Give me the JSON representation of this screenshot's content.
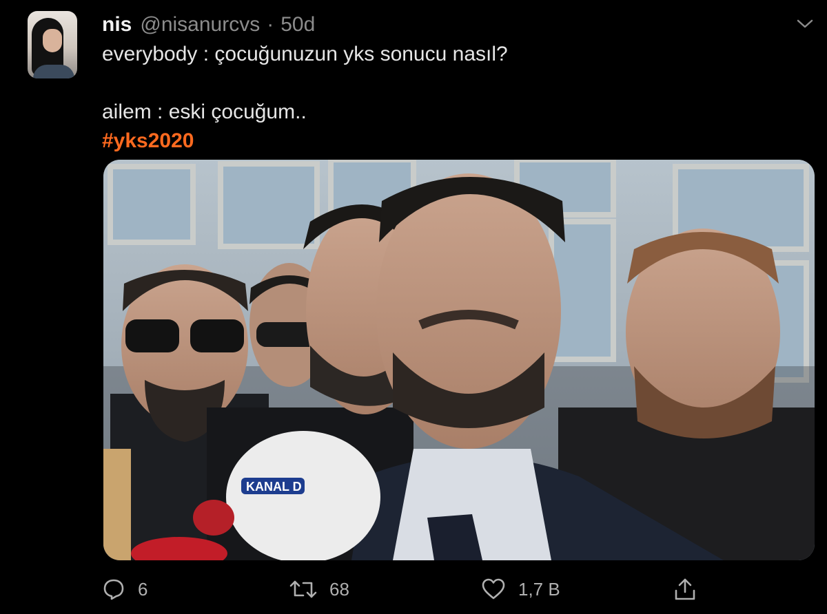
{
  "tweet": {
    "author_name": "nis",
    "author_handle": "@nisanurcvs",
    "separator": "·",
    "timestamp": "50d",
    "text_lines": [
      "everybody : çocuğunuzun yks sonucu nasıl?",
      "ailem : eski çocuğum.."
    ],
    "hashtag": "#yks2020",
    "media_caption_on_mic": "KANAL D"
  },
  "actions": {
    "reply_count": "6",
    "retweet_count": "68",
    "like_count": "1,7 B"
  },
  "icons": {
    "menu": "chevron-down-icon",
    "reply": "reply-icon",
    "retweet": "retweet-icon",
    "like": "heart-icon",
    "share": "share-icon"
  },
  "colors": {
    "background": "#000000",
    "hashtag": "#ff6a1f",
    "secondary_text": "#8c8c8c"
  }
}
